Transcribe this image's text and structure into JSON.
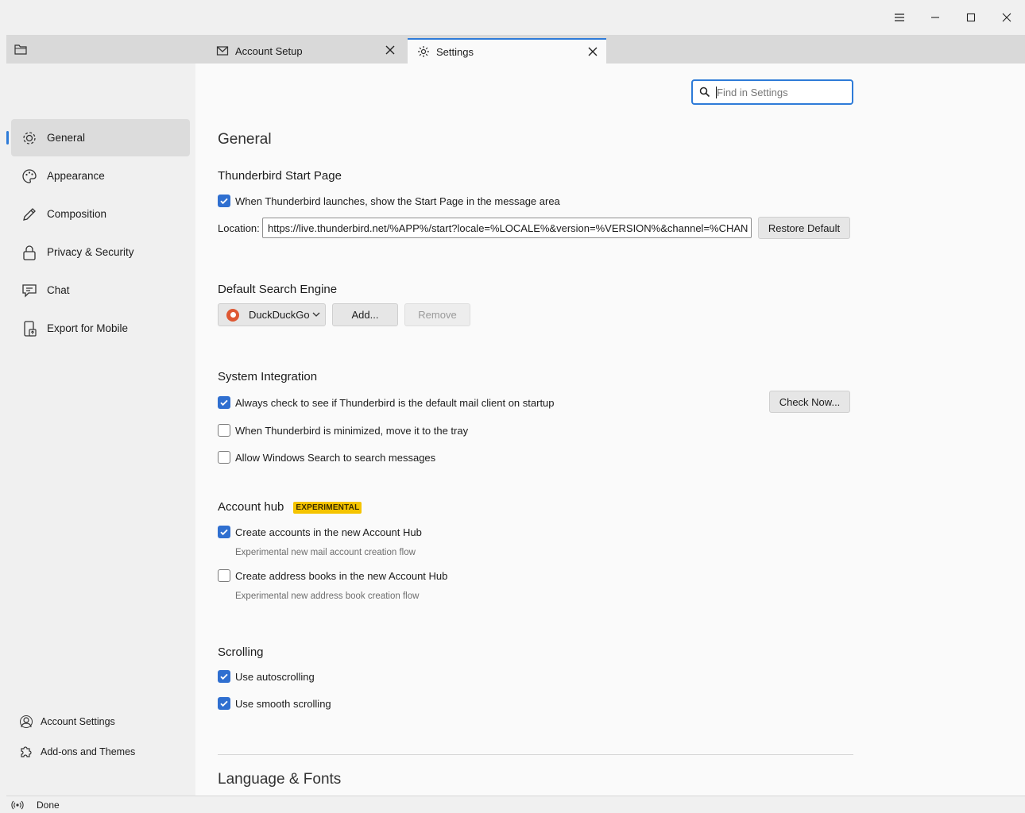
{
  "window": {
    "controls": [
      "menu-icon",
      "minimize-icon",
      "maximize-icon",
      "close-icon"
    ]
  },
  "tabs": [
    {
      "label": "Account Setup",
      "icon": "envelope-icon",
      "active": false
    },
    {
      "label": "Settings",
      "icon": "gear-icon",
      "active": true
    }
  ],
  "sidebar": {
    "categories": [
      {
        "label": "General",
        "icon": "gear-icon",
        "selected": true
      },
      {
        "label": "Appearance",
        "icon": "palette-icon",
        "selected": false
      },
      {
        "label": "Composition",
        "icon": "pencil-icon",
        "selected": false
      },
      {
        "label": "Privacy & Security",
        "icon": "lock-icon",
        "selected": false
      },
      {
        "label": "Chat",
        "icon": "chat-icon",
        "selected": false
      },
      {
        "label": "Export for Mobile",
        "icon": "mobile-export-icon",
        "selected": false
      }
    ],
    "footer": [
      {
        "label": "Account Settings",
        "icon": "account-icon"
      },
      {
        "label": "Add-ons and Themes",
        "icon": "puzzle-icon"
      }
    ]
  },
  "search": {
    "placeholder": "Find in Settings",
    "value": ""
  },
  "general": {
    "title": "General",
    "start_page": {
      "heading": "Thunderbird Start Page",
      "launch_checkbox": {
        "label": "When Thunderbird launches, show the Start Page in the message area",
        "checked": true
      },
      "location_label": "Location:",
      "location_value": "https://live.thunderbird.net/%APP%/start?locale=%LOCALE%&version=%VERSION%&channel=%CHAN",
      "restore_button": "Restore Default"
    },
    "search_engine": {
      "heading": "Default Search Engine",
      "selected": "DuckDuckGo",
      "add_button": "Add...",
      "remove_button": "Remove"
    },
    "system_integration": {
      "heading": "System Integration",
      "default_client": {
        "label": "Always check to see if Thunderbird is the default mail client on startup",
        "checked": true
      },
      "check_now_button": "Check Now...",
      "minimize_tray": {
        "label": "When Thunderbird is minimized, move it to the tray",
        "checked": false
      },
      "windows_search": {
        "label": "Allow Windows Search to search messages",
        "checked": false
      }
    },
    "account_hub": {
      "heading": "Account hub",
      "badge": "EXPERIMENTAL",
      "create_accounts": {
        "label": "Create accounts in the new Account Hub",
        "checked": true,
        "description": "Experimental new mail account creation flow"
      },
      "create_address_books": {
        "label": "Create address books in the new Account Hub",
        "checked": false,
        "description": "Experimental new address book creation flow"
      }
    },
    "scrolling": {
      "heading": "Scrolling",
      "autoscrolling": {
        "label": "Use autoscrolling",
        "checked": true
      },
      "smooth_scrolling": {
        "label": "Use smooth scrolling",
        "checked": true
      }
    },
    "language_fonts": {
      "heading": "Language & Fonts"
    }
  },
  "statusbar": {
    "text": "Done",
    "icon": "online-status-icon"
  },
  "colors": {
    "accent": "#2e7bd8",
    "checkbox": "#2f6fd0",
    "badge": "#f5c400"
  }
}
